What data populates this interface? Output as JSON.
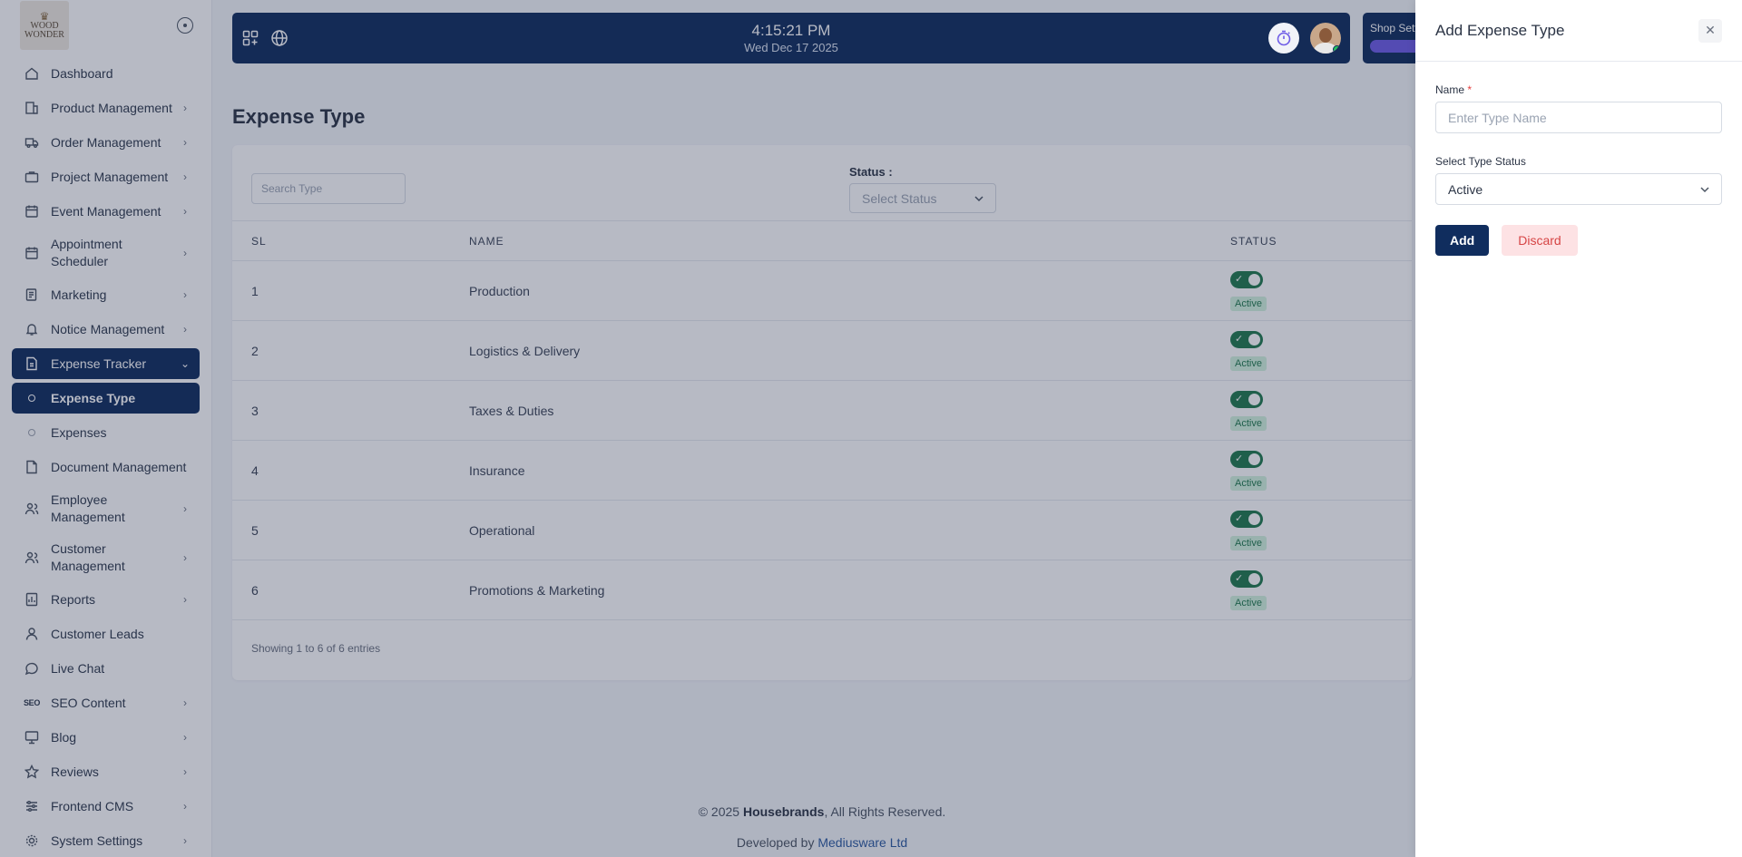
{
  "brand": {
    "logo_line1": "WOOD",
    "logo_line2": "WONDER"
  },
  "sidebar": {
    "items": [
      {
        "label": "Dashboard",
        "icon": "home-icon",
        "chevron": false
      },
      {
        "label": "Product Management",
        "icon": "product-icon",
        "chevron": true
      },
      {
        "label": "Order Management",
        "icon": "truck-icon",
        "chevron": true
      },
      {
        "label": "Project Management",
        "icon": "briefcase-icon",
        "chevron": true
      },
      {
        "label": "Event Management",
        "icon": "calendar-icon",
        "chevron": true
      },
      {
        "label": "Appointment Scheduler",
        "icon": "calendar-clock-icon",
        "chevron": true
      },
      {
        "label": "Marketing",
        "icon": "megaphone-icon",
        "chevron": true
      },
      {
        "label": "Notice Management",
        "icon": "bell-icon",
        "chevron": true
      },
      {
        "label": "Expense Tracker",
        "icon": "receipt-icon",
        "chevron": true
      },
      {
        "label": "Expense Type"
      },
      {
        "label": "Expenses"
      },
      {
        "label": "Document Management",
        "icon": "document-icon",
        "chevron": false
      },
      {
        "label": "Employee Management",
        "icon": "users-icon",
        "chevron": true
      },
      {
        "label": "Customer Management",
        "icon": "customers-icon",
        "chevron": true
      },
      {
        "label": "Reports",
        "icon": "report-icon",
        "chevron": true
      },
      {
        "label": "Customer Leads",
        "icon": "user-icon",
        "chevron": false
      },
      {
        "label": "Live Chat",
        "icon": "chat-icon",
        "chevron": false
      },
      {
        "label": "SEO Content",
        "icon": "seo-icon",
        "icon_text": "SEO",
        "chevron": true
      },
      {
        "label": "Blog",
        "icon": "blog-icon",
        "chevron": true
      },
      {
        "label": "Reviews",
        "icon": "star-icon",
        "chevron": true
      },
      {
        "label": "Frontend CMS",
        "icon": "sliders-icon",
        "chevron": true
      },
      {
        "label": "System Settings",
        "icon": "gear-icon",
        "chevron": true
      }
    ]
  },
  "topbar": {
    "time": "4:15:21 PM",
    "date": "Wed Dec 17 2025",
    "shop_settings_label": "Shop Sett"
  },
  "main": {
    "title": "Expense Type",
    "search_placeholder": "Search Type",
    "status_label": "Status :",
    "status_placeholder": "Select Status",
    "columns": {
      "sl": "SL",
      "name": "NAME",
      "status": "STATUS"
    },
    "rows": [
      {
        "sl": "1",
        "name": "Production",
        "status": "Active"
      },
      {
        "sl": "2",
        "name": "Logistics & Delivery",
        "status": "Active"
      },
      {
        "sl": "3",
        "name": "Taxes & Duties",
        "status": "Active"
      },
      {
        "sl": "4",
        "name": "Insurance",
        "status": "Active"
      },
      {
        "sl": "5",
        "name": "Operational",
        "status": "Active"
      },
      {
        "sl": "6",
        "name": "Promotions & Marketing",
        "status": "Active"
      }
    ],
    "showing": "Showing 1 to 6 of 6 entries"
  },
  "footer": {
    "copyright_prefix": "© 2025 ",
    "company": "Housebrands",
    "copyright_suffix": ", All Rights Reserved.",
    "developed_prefix": "Developed by ",
    "developer": "Mediusware Ltd"
  },
  "drawer": {
    "title": "Add Expense Type",
    "name_label": "Name",
    "required_mark": "*",
    "name_value": "",
    "name_placeholder": "Enter Type Name",
    "status_label": "Select Type Status",
    "status_value": "Active",
    "add_label": "Add",
    "discard_label": "Discard"
  },
  "colors": {
    "primary": "#102d5e",
    "active_green": "#1f7a4d",
    "danger": "#d64545",
    "required": "#e53e3e"
  }
}
